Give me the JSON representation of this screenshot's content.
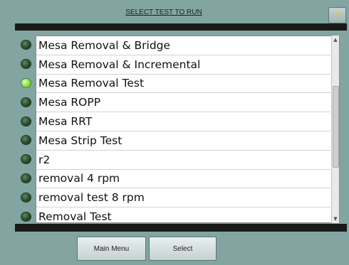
{
  "header": {
    "title": "SELECT TEST TO RUN",
    "help_label": "?"
  },
  "tests": [
    {
      "label": "Mesa Removal & Bridge",
      "active": false
    },
    {
      "label": "Mesa Removal & Incremental",
      "active": false
    },
    {
      "label": "Mesa Removal Test",
      "active": true
    },
    {
      "label": "Mesa ROPP",
      "active": false
    },
    {
      "label": "Mesa RRT",
      "active": false
    },
    {
      "label": "Mesa Strip Test",
      "active": false
    },
    {
      "label": "r2",
      "active": false
    },
    {
      "label": "removal 4 rpm",
      "active": false
    },
    {
      "label": "removal test 8 rpm",
      "active": false
    },
    {
      "label": "Removal Test",
      "active": false
    }
  ],
  "footer": {
    "main_menu_label": "Main Menu",
    "select_label": "Select"
  },
  "colors": {
    "background": "#83a5a2",
    "led_active": "#8fe84a",
    "led_inactive": "#2b4a2b",
    "help_glyph": "#e8c33a"
  }
}
